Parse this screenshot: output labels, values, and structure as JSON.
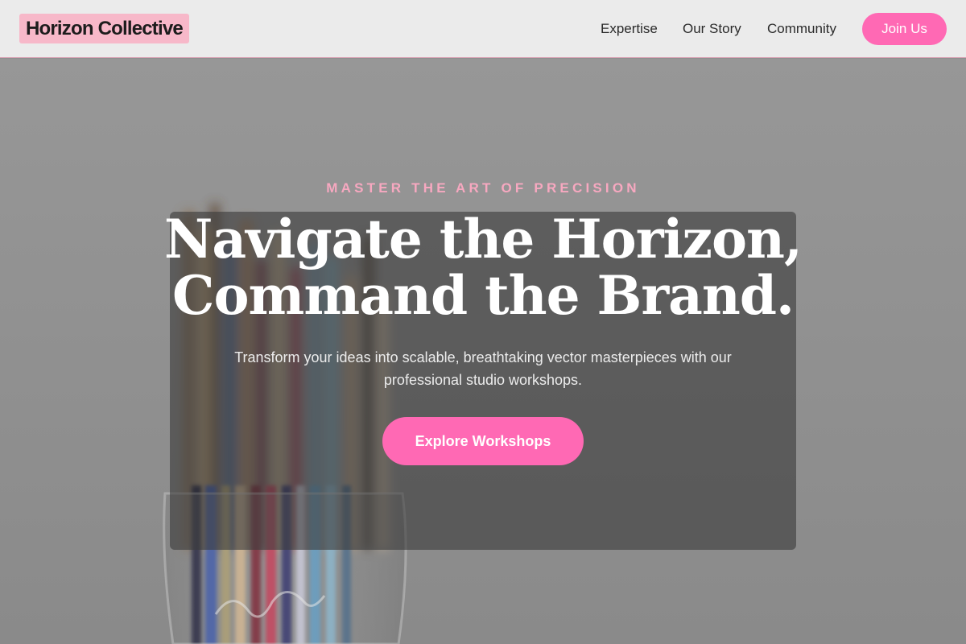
{
  "header": {
    "logo": "Horizon Collective",
    "nav": [
      "Expertise",
      "Our Story",
      "Community"
    ],
    "cta_label": "Join Us"
  },
  "hero": {
    "eyebrow": "MASTER THE ART OF PRECISION",
    "headline_line1": "Navigate the Horizon,",
    "headline_line2": "Command the Brand.",
    "subtext": "Transform your ideas into scalable, breathtaking vector masterpieces with our professional studio workshops.",
    "cta_label": "Explore Workshops"
  },
  "colors": {
    "accent": "#ff69b4",
    "logo_bg": "#f7b8c9",
    "eyebrow": "#f7a8c0",
    "header_bg": "#ebebeb"
  }
}
